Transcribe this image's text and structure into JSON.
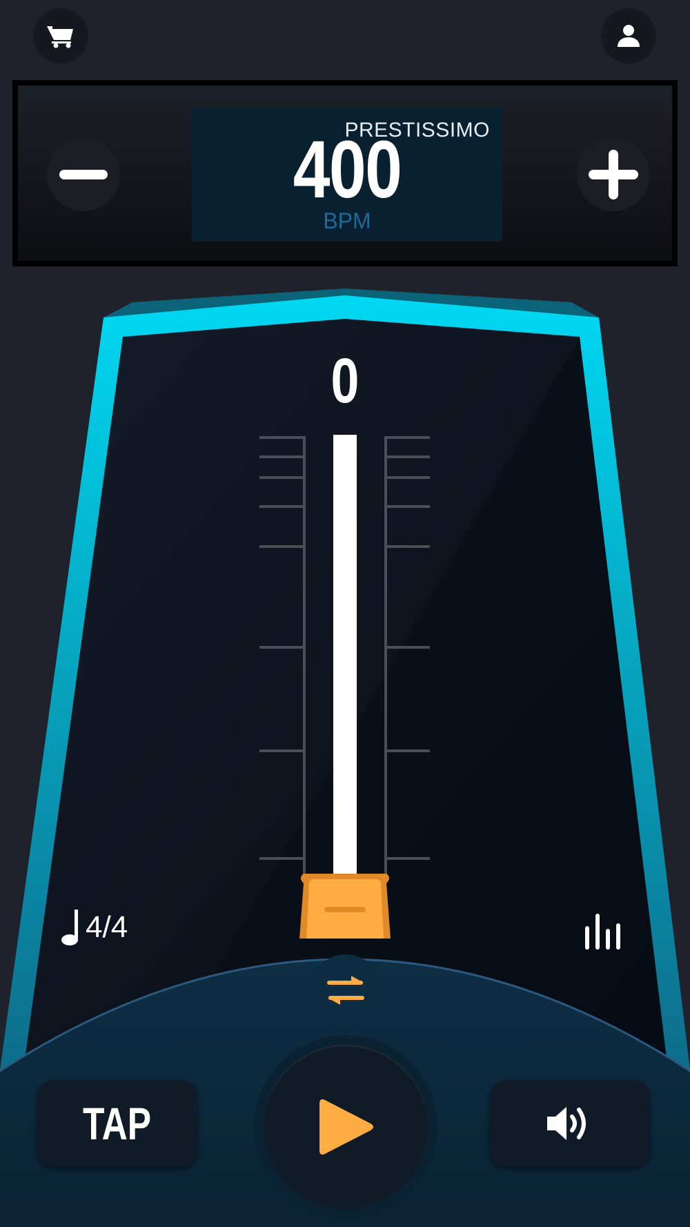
{
  "header": {
    "cart_icon": "cart-icon",
    "profile_icon": "user-icon"
  },
  "tempo": {
    "marking": "PRESTISSIMO",
    "bpm": "400",
    "unit": "BPM",
    "decrease_icon": "minus-icon",
    "increase_icon": "plus-icon"
  },
  "metronome": {
    "beat_count": "0",
    "time_signature": "4/4",
    "note_icon": "quarter-note-icon",
    "stats_icon": "bar-levels-icon",
    "swap_icon": "swap-arrows-icon"
  },
  "controls": {
    "tap_label": "TAP",
    "play_icon": "play-icon",
    "sound_icon": "speaker-icon"
  },
  "colors": {
    "accent": "#ffad42",
    "frame": "#00d4f0",
    "background": "#1f222a"
  }
}
